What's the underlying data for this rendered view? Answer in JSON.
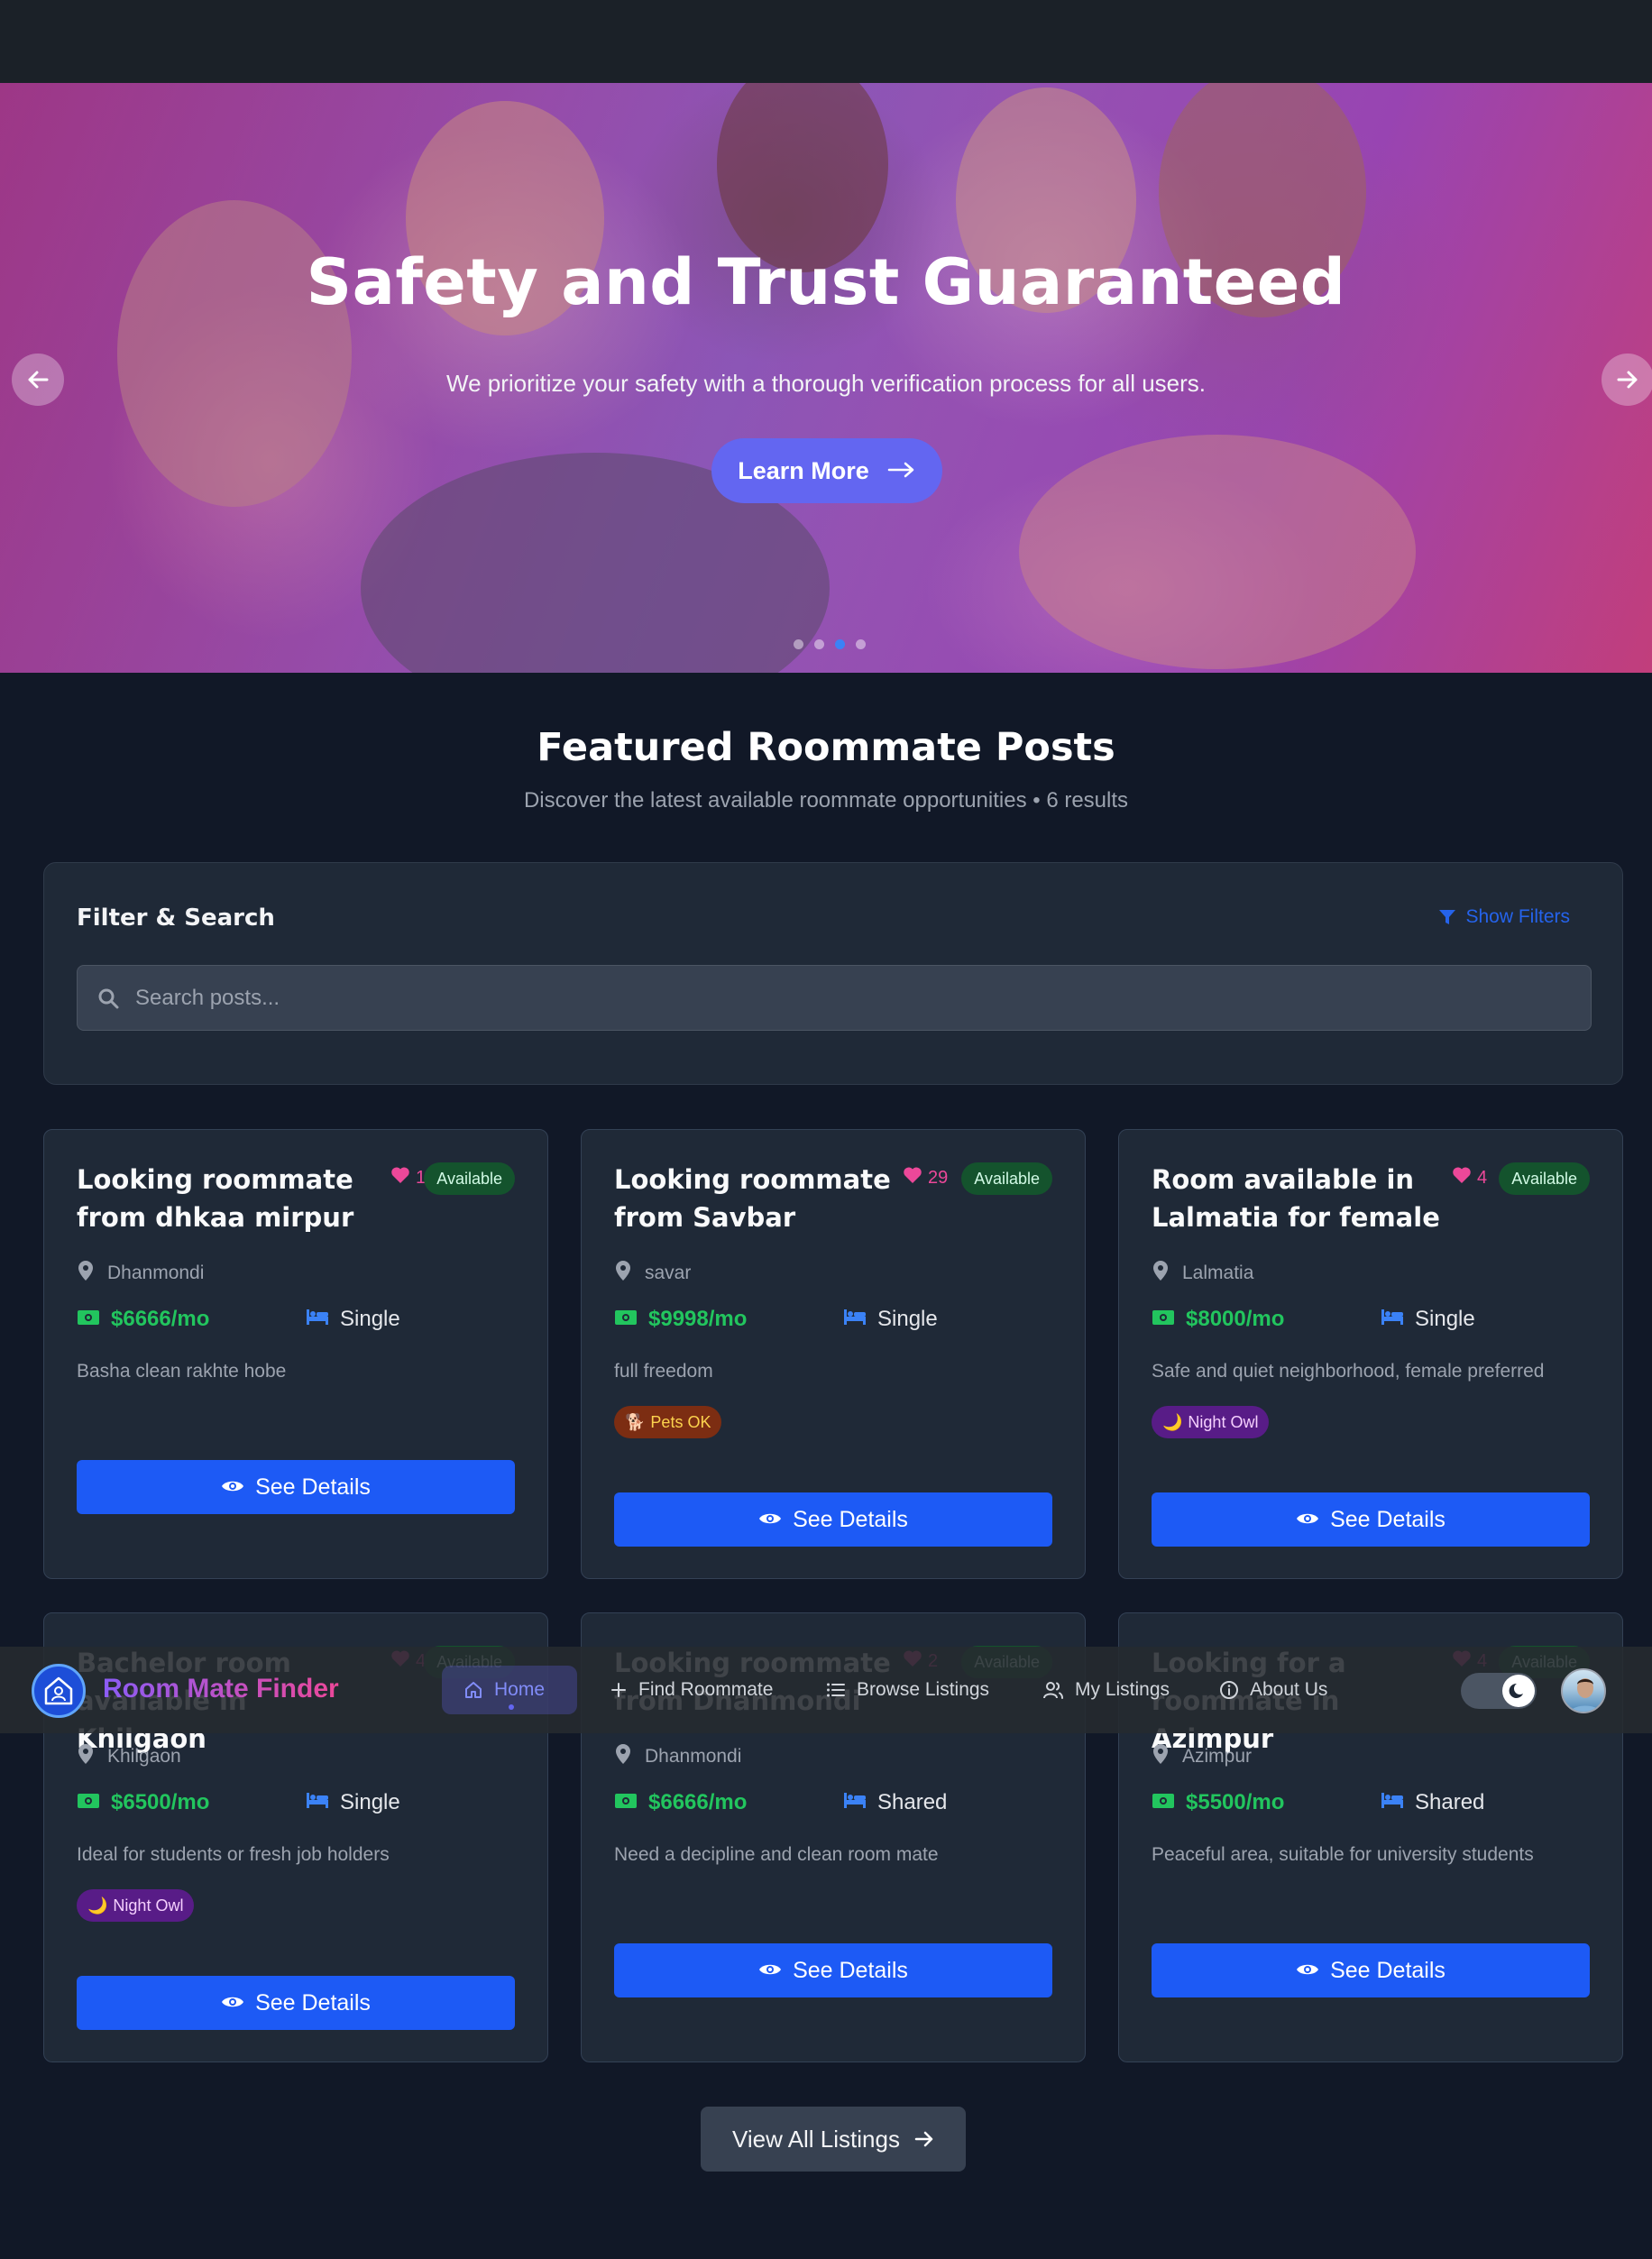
{
  "hero": {
    "title": "Safety and Trust Guaranteed",
    "subtitle": "We prioritize your safety with a thorough verification process for all users.",
    "button_label": "Learn More",
    "slides_total": 4,
    "active_slide": 3
  },
  "featured": {
    "title": "Featured Roommate Posts",
    "subtitle": "Discover the latest available roommate opportunities • 6 results"
  },
  "filter": {
    "title": "Filter & Search",
    "show_filters_label": "Show Filters",
    "search_placeholder": "Search posts..."
  },
  "cards": [
    {
      "title": "Looking roommate from dhkaa mirpur",
      "likes": "1",
      "status": "Available",
      "location": "Dhanmondi",
      "price": "$6666/mo",
      "room_type": "Single",
      "description": "Basha clean rakhte hobe",
      "tag": "",
      "button": "See Details"
    },
    {
      "title": "Looking roommate from Savbar",
      "likes": "29",
      "status": "Available",
      "location": "savar",
      "price": "$9998/mo",
      "room_type": "Single",
      "description": "full freedom",
      "tag": "Pets OK",
      "button": "See Details"
    },
    {
      "title": "Room available in Lalmatia for female",
      "likes": "4",
      "status": "Available",
      "location": "Lalmatia",
      "price": "$8000/mo",
      "room_type": "Single",
      "description": "Safe and quiet neighborhood, female preferred",
      "tag": "Night Owl",
      "button": "See Details"
    },
    {
      "title": "Bachelor room available in Khilgaon",
      "likes": "4",
      "status": "Available",
      "location": "Khilgaon",
      "price": "$6500/mo",
      "room_type": "Single",
      "description": "Ideal for students or fresh job holders",
      "tag": "Night Owl",
      "button": "See Details"
    },
    {
      "title": "Looking roommate from Dhanmondi",
      "likes": "2",
      "status": "Available",
      "location": "Dhanmondi",
      "price": "$6666/mo",
      "room_type": "Shared",
      "description": "Need a decipline and clean room mate",
      "tag": "",
      "button": "See Details"
    },
    {
      "title": "Looking for a roommate in Azimpur",
      "likes": "4",
      "status": "Available",
      "location": "Azimpur",
      "price": "$5500/mo",
      "room_type": "Shared",
      "description": "Peaceful area, suitable for university students",
      "tag": "",
      "button": "See Details"
    }
  ],
  "view_all_label": "View All Listings",
  "nav": {
    "brand": "Room Mate Finder",
    "items": [
      {
        "label": "Home",
        "icon": "home-icon",
        "active": true
      },
      {
        "label": "Find Roommate",
        "icon": "plus-icon",
        "active": false
      },
      {
        "label": "Browse Listings",
        "icon": "list-icon",
        "active": false
      },
      {
        "label": "My Listings",
        "icon": "users-icon",
        "active": false
      },
      {
        "label": "About Us",
        "icon": "info-icon",
        "active": false
      }
    ],
    "theme": "dark"
  },
  "colors": {
    "accent": "#6366f1",
    "primary_button": "#1d5af5",
    "price": "#22c55e",
    "like": "#ec4899",
    "available_badge": "#14532d"
  }
}
